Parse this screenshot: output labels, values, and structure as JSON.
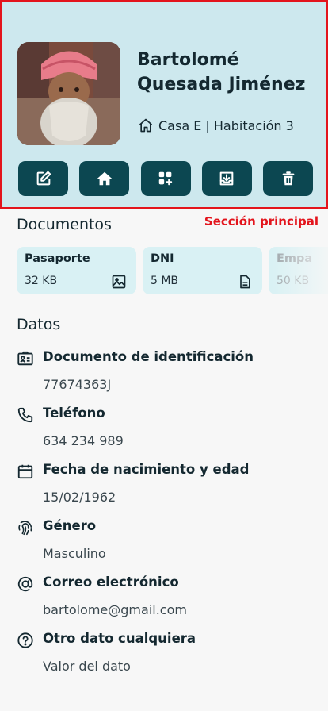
{
  "header": {
    "section_tag": "Sección principal",
    "name": "Bartolomé Quesada Jiménez",
    "location": "Casa E | Habitación 3",
    "actions": [
      "edit-icon",
      "home-icon",
      "add-widget-icon",
      "download-icon",
      "trash-icon"
    ]
  },
  "documents": {
    "title": "Documentos",
    "items": [
      {
        "name": "Pasaporte",
        "size": "32 KB",
        "icon": "image-icon"
      },
      {
        "name": "DNI",
        "size": "5 MB",
        "icon": "file-text-icon"
      },
      {
        "name": "Empa",
        "size": "50 KB",
        "icon": ""
      }
    ]
  },
  "datos": {
    "title": "Datos",
    "fields": [
      {
        "label": "Documento de identificación",
        "value": "77674363J",
        "icon": "id-card-icon"
      },
      {
        "label": "Teléfono",
        "value": "634 234 989",
        "icon": "phone-icon"
      },
      {
        "label": "Fecha de nacimiento y edad",
        "value": "15/02/1962",
        "icon": "calendar-icon"
      },
      {
        "label": "Género",
        "value": "Masculino",
        "icon": "fingerprint-icon"
      },
      {
        "label": "Correo electrónico",
        "value": "bartolome@gmail.com",
        "icon": "at-icon"
      },
      {
        "label": "Otro dato cualquiera",
        "value": "Valor del dato",
        "icon": "help-circle-icon"
      }
    ]
  },
  "colors": {
    "hero_bg": "#cde8ee",
    "accent": "#0c4751",
    "doc_bg": "#d9f1f4",
    "highlight": "#e3141c"
  }
}
